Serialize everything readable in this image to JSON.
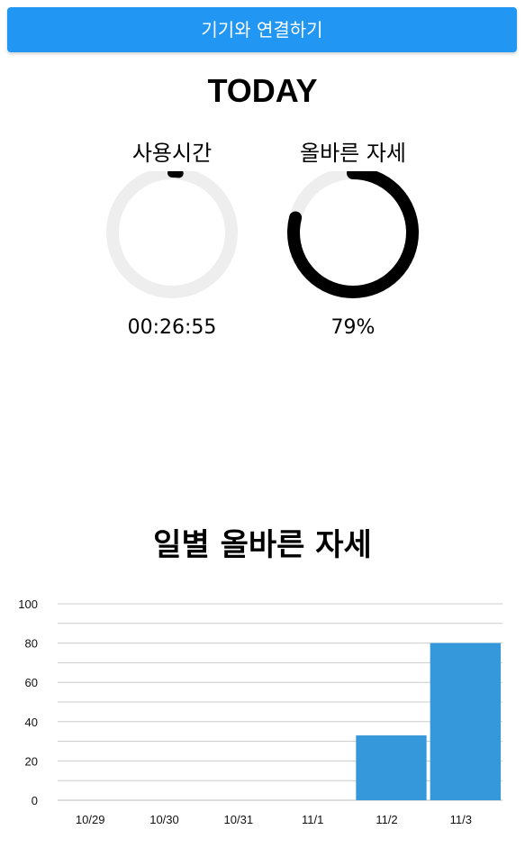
{
  "connect_button": {
    "label": "기기와 연결하기"
  },
  "today": {
    "title": "TODAY",
    "usage": {
      "label": "사용시간",
      "value": "00:26:55",
      "fraction": 0.0187
    },
    "posture": {
      "label": "올바른 자세",
      "value": "79%",
      "fraction": 0.79
    }
  },
  "colors": {
    "accent": "#2196f3",
    "bar": "#3498db",
    "ring_track": "#eeeeee",
    "ring_fill": "#000000"
  },
  "chart": {
    "title": "일별 올바른 자세"
  },
  "chart_data": {
    "type": "bar",
    "title": "일별 올바른 자세",
    "categories": [
      "10/29",
      "10/30",
      "10/31",
      "11/1",
      "11/2",
      "11/3"
    ],
    "values": [
      0,
      0,
      0,
      0,
      33,
      80
    ],
    "ylim": [
      0,
      100
    ],
    "yticks": [
      "0",
      "20",
      "40",
      "60",
      "80",
      "100"
    ],
    "grid": true
  }
}
